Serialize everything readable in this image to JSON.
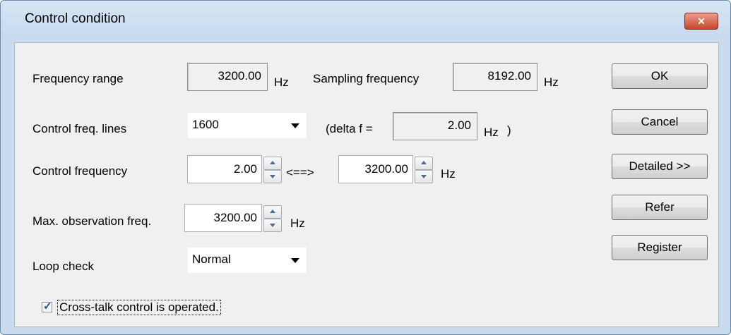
{
  "window": {
    "title": "Control condition",
    "close_label": "✕"
  },
  "frequency_range": {
    "label": "Frequency range",
    "value": "3200.00",
    "unit": "Hz"
  },
  "sampling_frequency": {
    "label": "Sampling frequency",
    "value": "8192.00",
    "unit": "Hz"
  },
  "control_freq_lines": {
    "label": "Control freq. lines",
    "selected": "1600",
    "delta_prefix": "(delta f =",
    "delta_value": "2.00",
    "delta_unit": "Hz",
    "delta_suffix": ")"
  },
  "control_frequency": {
    "label": "Control frequency",
    "from": "2.00",
    "separator": "<==>",
    "to": "3200.00",
    "unit": "Hz"
  },
  "max_observation": {
    "label": "Max. observation freq.",
    "value": "3200.00",
    "unit": "Hz"
  },
  "loop_check": {
    "label": "Loop check",
    "selected": "Normal"
  },
  "cross_talk": {
    "label": "Cross-talk control is operated.",
    "checked": true
  },
  "buttons": {
    "ok": "OK",
    "cancel": "Cancel",
    "detailed": "Detailed >>",
    "refer": "Refer",
    "register": "Register"
  }
}
